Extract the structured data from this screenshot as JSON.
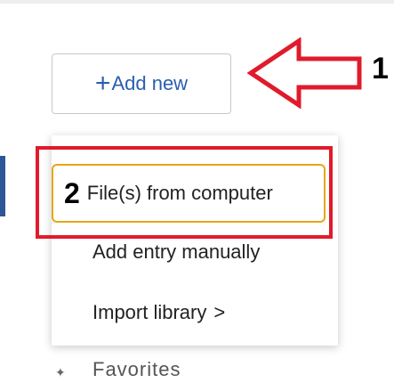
{
  "toolbar": {
    "add_new_label": "Add new",
    "plus_symbol": "+"
  },
  "annotations": {
    "step_1": "1",
    "step_2": "2",
    "arrow_color": "#e01b2b",
    "highlight_color": "#e01b2b"
  },
  "dropdown": {
    "items": [
      {
        "label": "File(s) from computer",
        "highlighted": true
      },
      {
        "label": "Add entry manually"
      },
      {
        "label": "Import library",
        "has_submenu": true,
        "chevron": ">"
      }
    ]
  },
  "sidebar_below": {
    "partial_label": "Favorites",
    "icon": "star-icon"
  },
  "colors": {
    "accent": "#2a5db0",
    "focus_outline": "#e7a613",
    "sidebar_accent": "#2e5597"
  }
}
